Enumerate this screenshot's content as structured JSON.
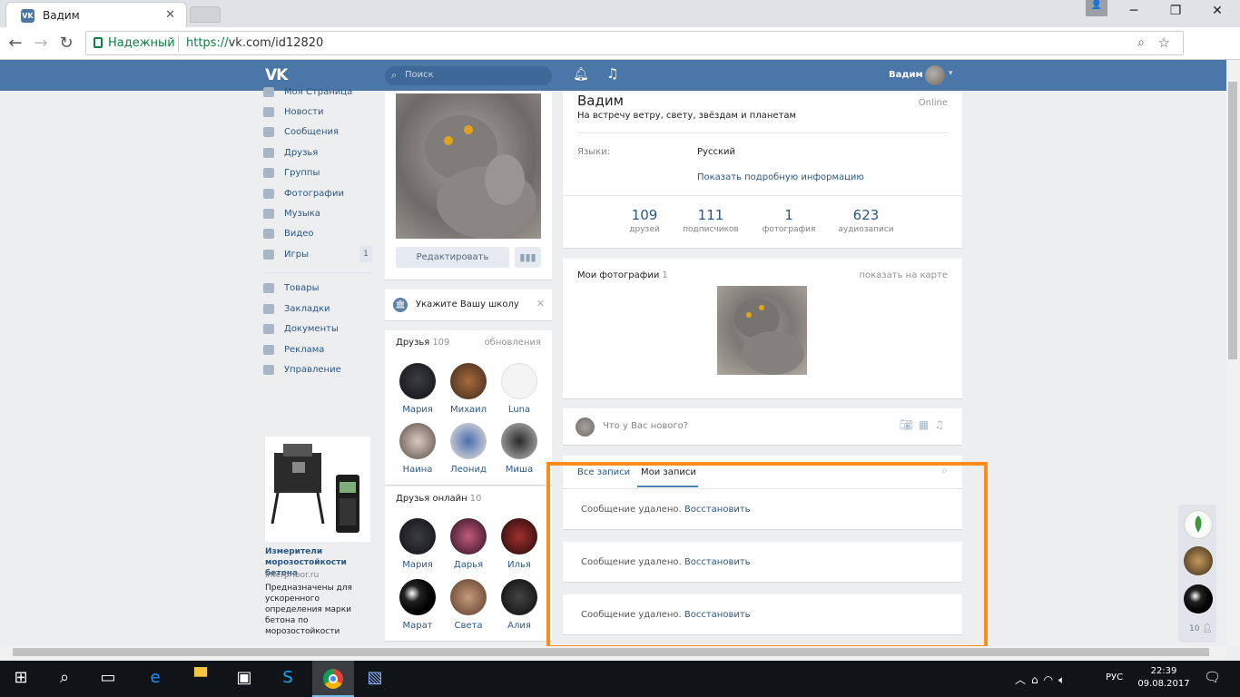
{
  "browser": {
    "tab_title": "Вадим",
    "tab_favicon": "VK",
    "secure_label": "Надежный",
    "url_prefix": "https://",
    "url_rest": "vk.com/id12820",
    "icons": [
      "back-icon",
      "forward-icon",
      "reload-icon",
      "lock-icon",
      "zoom-icon",
      "star-icon",
      "extension-icon",
      "menu-icon"
    ]
  },
  "vk_header": {
    "logo": "VK",
    "search_placeholder": "Поиск",
    "user_name": "Вадим",
    "brand_color": "#4a76a8"
  },
  "left_menu": {
    "items": [
      {
        "label": "Моя Страница"
      },
      {
        "label": "Новости"
      },
      {
        "label": "Сообщения"
      },
      {
        "label": "Друзья"
      },
      {
        "label": "Группы"
      },
      {
        "label": "Фотографии"
      },
      {
        "label": "Музыка"
      },
      {
        "label": "Видео"
      },
      {
        "label": "Игры",
        "badge": "1"
      },
      {
        "label": "Товары"
      },
      {
        "label": "Закладки"
      },
      {
        "label": "Документы"
      },
      {
        "label": "Реклама"
      },
      {
        "label": "Управление"
      }
    ]
  },
  "ad": {
    "title": "Измерители морозостойкости бетона",
    "domain": "interpribor.ru",
    "text": "Предназначены для ускоренного определения марки бетона по морозостойкости"
  },
  "profile_side": {
    "edit_label": "Редактировать",
    "stats_icon": "stats-icon",
    "school_prompt": "Укажите Вашу школу",
    "friends_title": "Друзья",
    "friends_count": "109",
    "friends_updates": "обновления",
    "friends": [
      "Мария",
      "Михаил",
      "Luna",
      "Наина",
      "Леонид",
      "Миша"
    ],
    "online_title": "Друзья онлайн",
    "online_count": "10",
    "online_friends": [
      "Мария",
      "Дарья",
      "Илья",
      "Марат",
      "Света",
      "Алия"
    ]
  },
  "profile": {
    "name": "Вадим",
    "status": "На встречу ветру, свету, звёздам и планетам",
    "online": "Online",
    "lang_label": "Языки:",
    "lang_value": "Русский",
    "more_info": "Показать подробную информацию",
    "counters": [
      {
        "n": "109",
        "l": "друзей"
      },
      {
        "n": "111",
        "l": "подписчиков"
      },
      {
        "n": "1",
        "l": "фотография"
      },
      {
        "n": "623",
        "l": "аудиозаписи"
      }
    ]
  },
  "photos": {
    "title": "Мои фотографии",
    "count": "1",
    "map_link": "показать на карте"
  },
  "new_post": {
    "placeholder": "Что у Вас нового?"
  },
  "wall": {
    "tab_all": "Все записи",
    "tab_mine": "Мои записи",
    "deleted_text": "Сообщение удалено.",
    "restore": "Восстановить",
    "highlight_color": "#ff8c1a"
  },
  "dock": {
    "count": "10"
  },
  "taskbar": {
    "lang": "РУС",
    "time": "22:39",
    "date": "09.08.2017"
  }
}
